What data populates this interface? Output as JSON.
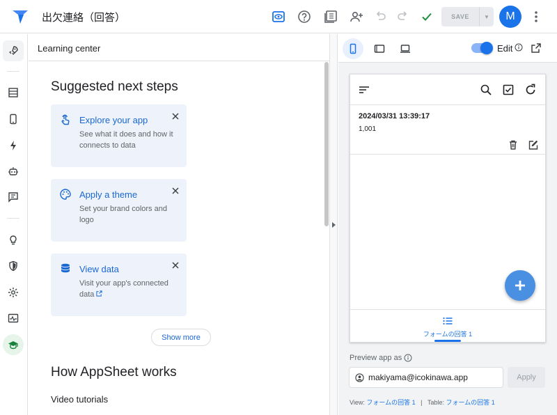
{
  "app": {
    "title": "出欠連絡（回答）",
    "save_label": "SAVE",
    "avatar_initial": "M",
    "accent": "#1a73e8"
  },
  "left_nav": {
    "items": [
      "rocket-icon",
      "data-icon",
      "views-icon",
      "automation-icon",
      "bot-icon",
      "chat-icon",
      "lightbulb-icon",
      "security-icon",
      "settings-icon",
      "monitor-icon",
      "learning-icon"
    ]
  },
  "learning": {
    "header": "Learning center",
    "suggested_title": "Suggested next steps",
    "cards": [
      {
        "title": "Explore your app",
        "desc": "See what it does and how it connects to data"
      },
      {
        "title": "Apply a theme",
        "desc": "Set your brand colors and logo"
      },
      {
        "title": "View data",
        "desc": "Visit your app's connected data"
      }
    ],
    "show_more": "Show more",
    "how_title": "How AppSheet works",
    "video_title": "Video tutorials"
  },
  "preview": {
    "edit_label": "Edit",
    "record": {
      "timestamp": "2024/03/31 13:39:17",
      "value": "1,001"
    },
    "nav_label": "フォームの回答 1",
    "preview_as_label": "Preview app as",
    "preview_as_value": "makiyama@icokinawa.app",
    "apply_label": "Apply",
    "footer": {
      "view_label": "View:",
      "view_value": "フォームの回答 1",
      "sep": "|",
      "table_label": "Table:",
      "table_value": "フォームの回答 1"
    }
  }
}
